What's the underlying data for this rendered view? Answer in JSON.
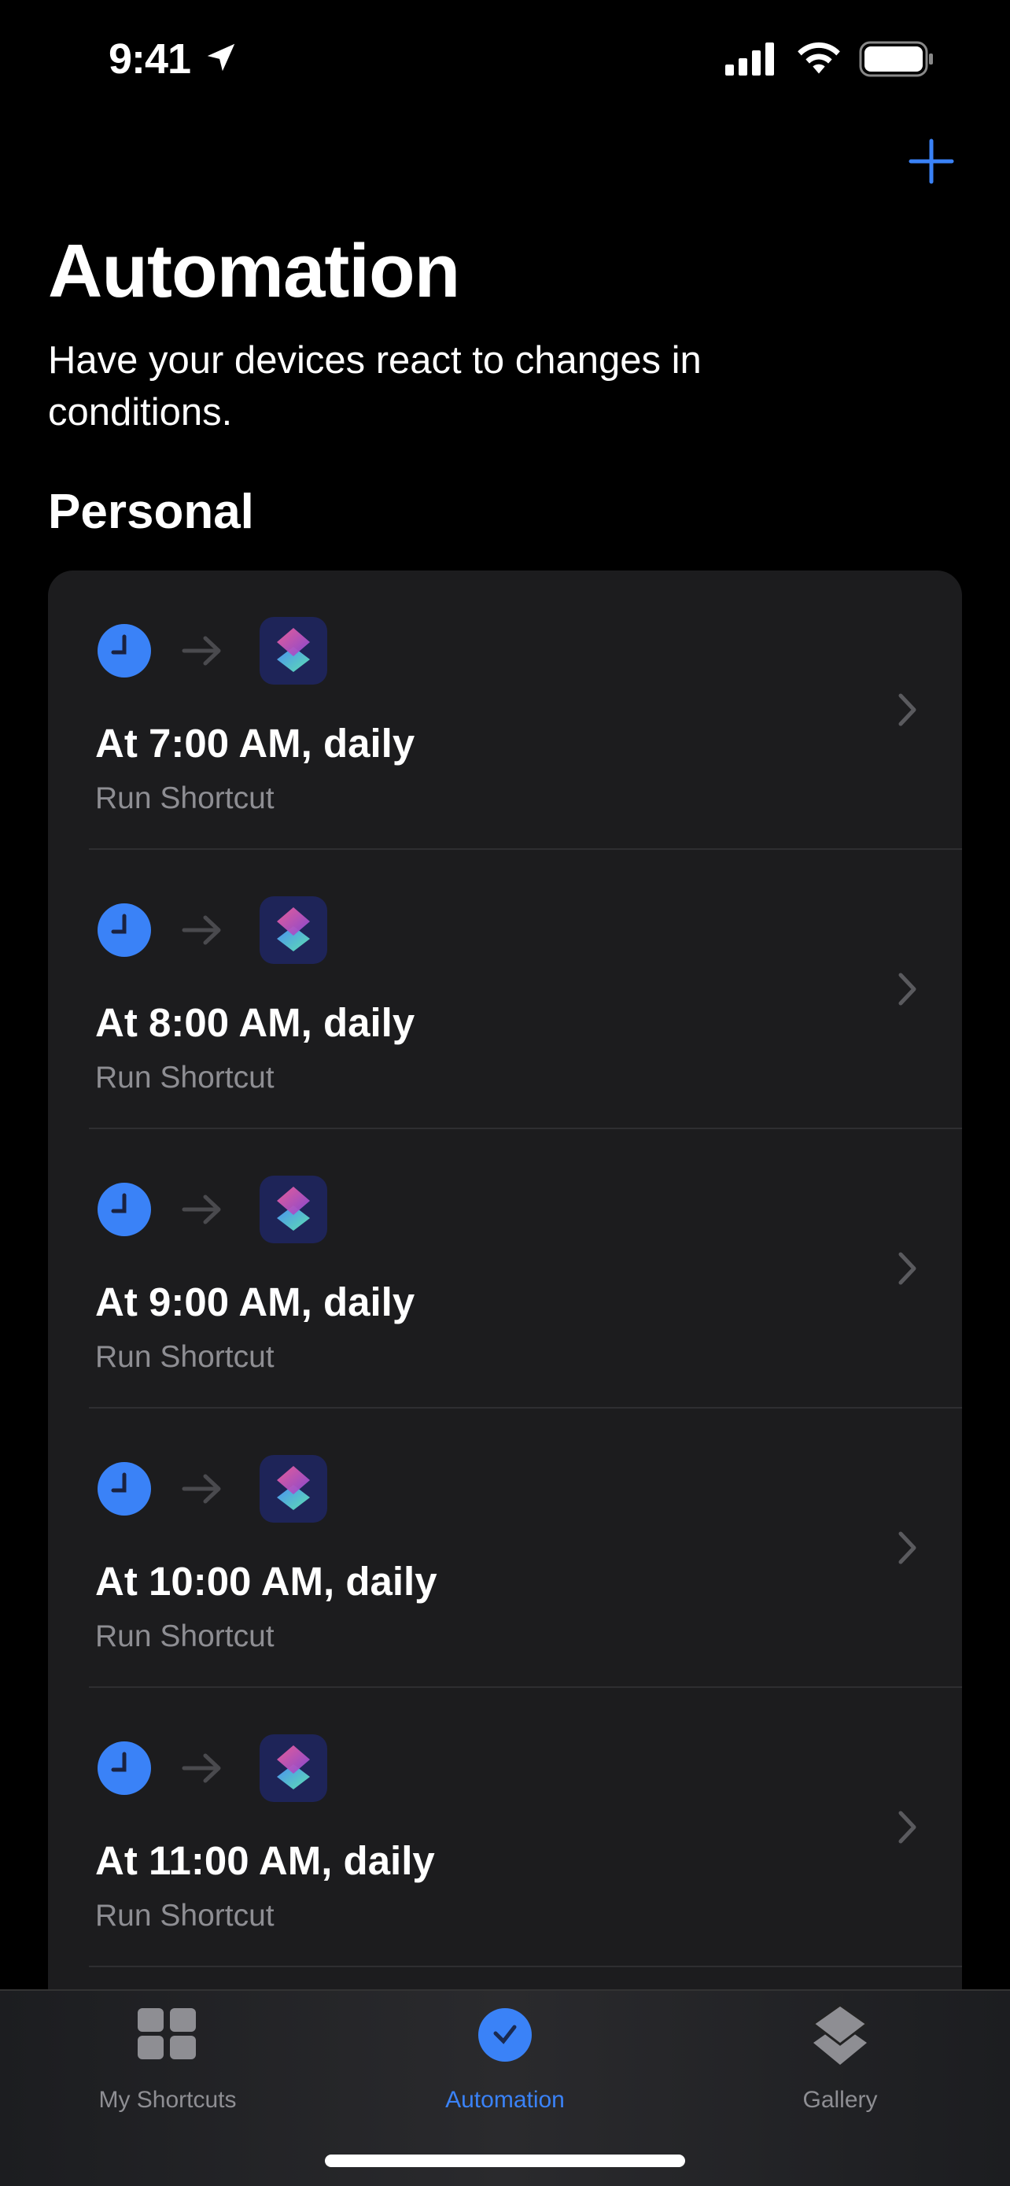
{
  "status_bar": {
    "time": "9:41"
  },
  "header": {
    "add_icon": "plus-icon",
    "title": "Automation",
    "subtitle": "Have your devices react to changes in conditions.",
    "accent": "#3a82f7"
  },
  "section": {
    "title": "Personal"
  },
  "automations": [
    {
      "title": "At 7:00 AM, daily",
      "subtitle": "Run Shortcut"
    },
    {
      "title": "At 8:00 AM, daily",
      "subtitle": "Run Shortcut"
    },
    {
      "title": "At 9:00 AM, daily",
      "subtitle": "Run Shortcut"
    },
    {
      "title": "At 10:00 AM, daily",
      "subtitle": "Run Shortcut"
    },
    {
      "title": "At 11:00 AM, daily",
      "subtitle": "Run Shortcut"
    }
  ],
  "tabbar": {
    "tabs": [
      {
        "label": "My Shortcuts",
        "active": false
      },
      {
        "label": "Automation",
        "active": true
      },
      {
        "label": "Gallery",
        "active": false
      }
    ]
  }
}
